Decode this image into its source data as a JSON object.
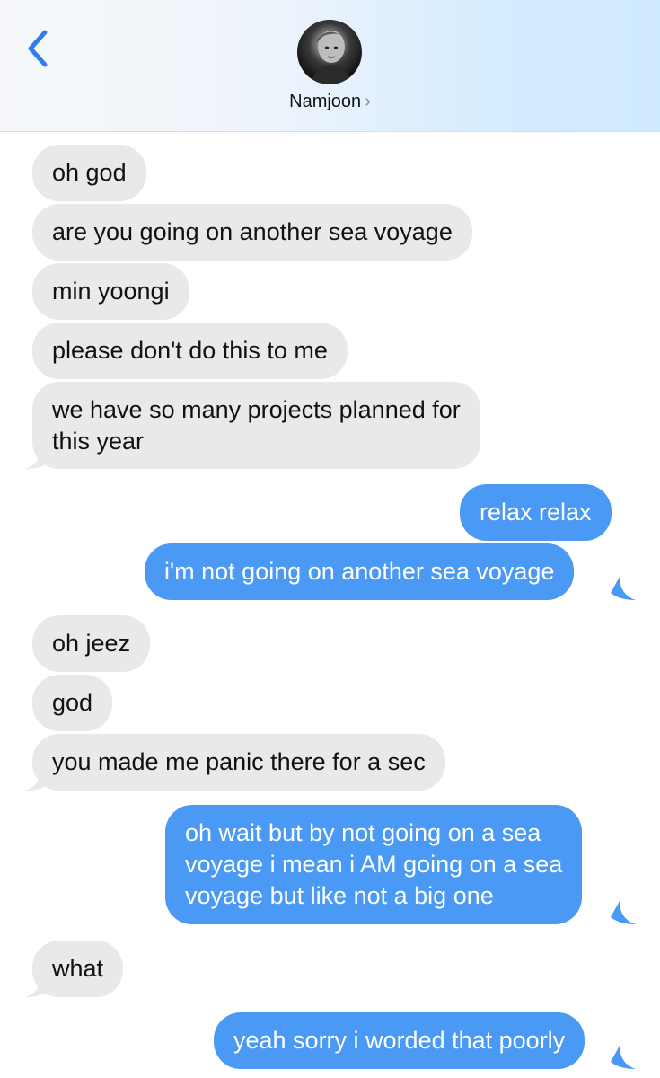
{
  "header": {
    "contact_name": "Namjoon",
    "chevron": "›",
    "back_icon": "chevron-left-icon",
    "accent_color": "#2f7df6"
  },
  "messages": [
    {
      "from": "them",
      "text": "oh god"
    },
    {
      "from": "them",
      "text": "are you going on another sea voyage"
    },
    {
      "from": "them",
      "text": "min yoongi"
    },
    {
      "from": "them",
      "text": "please don't do this to me"
    },
    {
      "from": "them",
      "lines": [
        "we have so many projects planned for",
        "this year"
      ]
    },
    {
      "from": "me",
      "text": "relax relax"
    },
    {
      "from": "me",
      "text": "i'm not going on another sea voyage"
    },
    {
      "from": "them",
      "text": "oh jeez"
    },
    {
      "from": "them",
      "text": "god"
    },
    {
      "from": "them",
      "text": "you made me panic there for a sec"
    },
    {
      "from": "me",
      "lines": [
        "oh wait but by not going on a sea",
        "voyage i mean i AM going on a sea",
        "voyage but like not a big one"
      ]
    },
    {
      "from": "them",
      "text": "what"
    },
    {
      "from": "me",
      "text": "yeah sorry i worded that poorly"
    }
  ],
  "colors": {
    "received_bubble": "#e9e9eb",
    "sent_bubble": "#4a9af5"
  }
}
